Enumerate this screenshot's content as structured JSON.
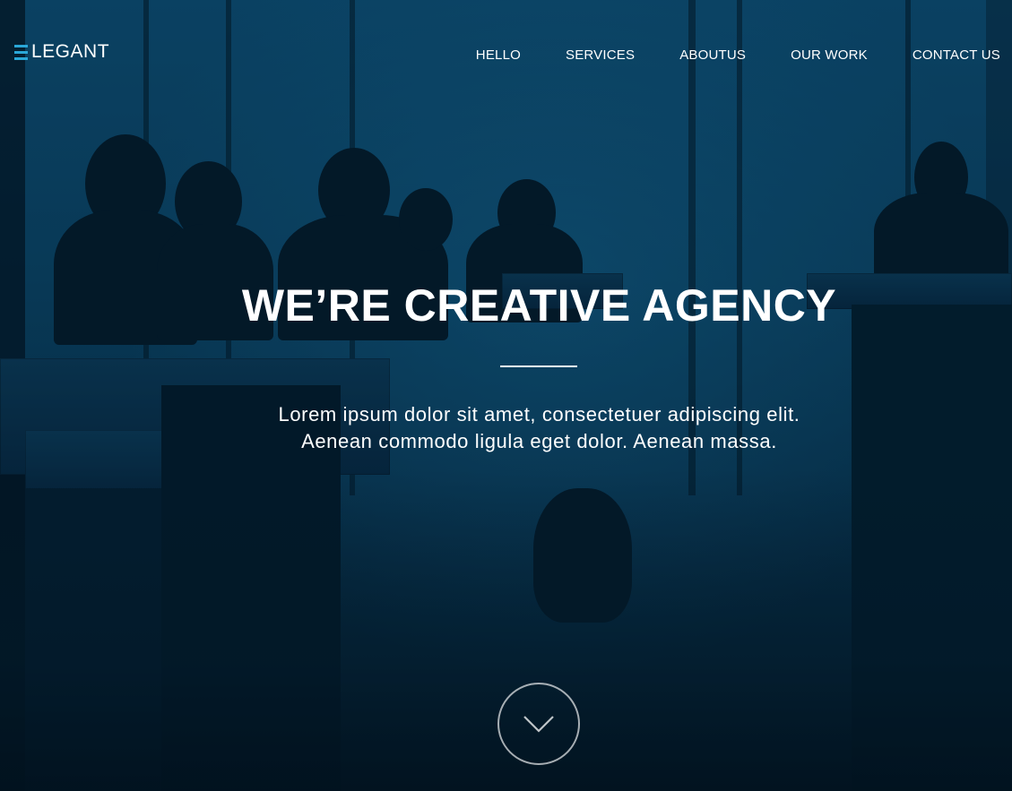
{
  "brand": {
    "logo_text": "LEGANT",
    "accent_color": "#2aa7d8"
  },
  "nav": {
    "items": [
      {
        "label": "HELLO"
      },
      {
        "label": "SERVICES"
      },
      {
        "label": "ABOUTUS"
      },
      {
        "label": "OUR WORK"
      },
      {
        "label": "CONTACT US"
      }
    ]
  },
  "hero": {
    "title": "WE’RE CREATIVE AGENCY",
    "subtitle_line1": "Lorem ipsum dolor sit amet, consectetuer adipiscing elit.",
    "subtitle_line2": "Aenean commodo ligula eget dolor. Aenean massa.",
    "scroll_icon": "chevron-down-icon",
    "background_tint": "#0a3f5e"
  }
}
